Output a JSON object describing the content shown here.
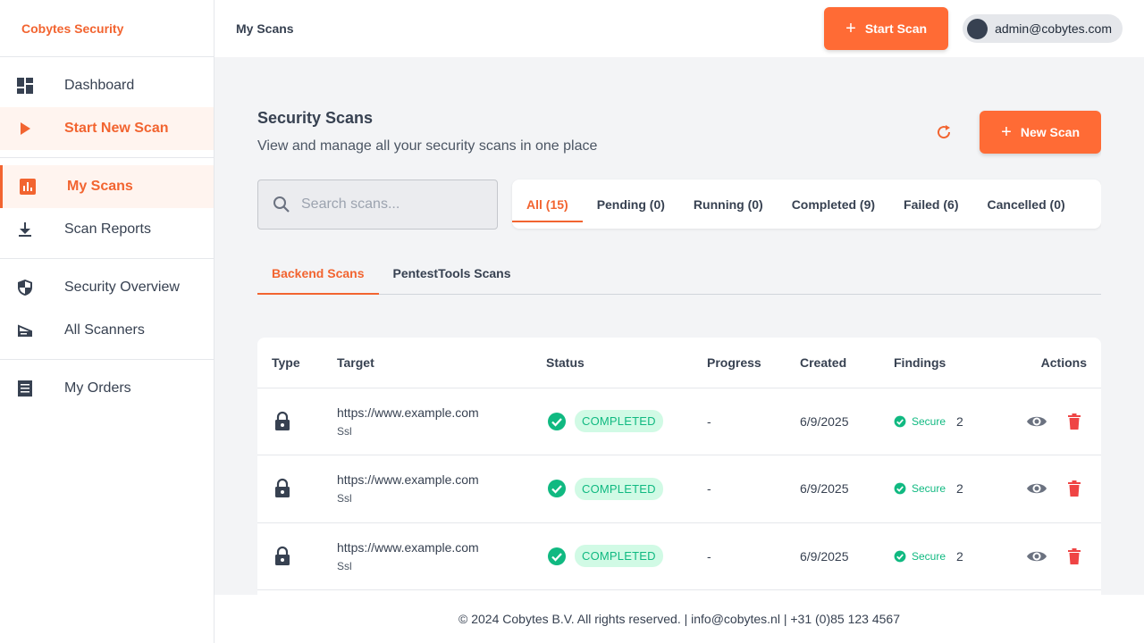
{
  "app": {
    "brand": "Cobytes Security"
  },
  "sidebar": {
    "groups": [
      [
        {
          "label": "Dashboard",
          "icon": "dashboard-icon"
        },
        {
          "label": "Start New Scan",
          "icon": "play-icon"
        }
      ],
      [
        {
          "label": "My Scans",
          "icon": "bar-chart-icon"
        },
        {
          "label": "Scan Reports",
          "icon": "download-icon"
        }
      ],
      [
        {
          "label": "Security Overview",
          "icon": "shield-icon"
        },
        {
          "label": "All Scanners",
          "icon": "scanner-icon"
        }
      ],
      [
        {
          "label": "My Orders",
          "icon": "receipt-icon"
        }
      ]
    ]
  },
  "header": {
    "title": "My Scans",
    "start_scan_label": "Start Scan",
    "user_email": "admin@cobytes.com"
  },
  "main": {
    "title": "Security Scans",
    "subtitle": "View and manage all your security scans in one place",
    "new_scan_label": "New Scan",
    "search_placeholder": "Search scans...",
    "filter_tabs": [
      "All (15)",
      "Pending (0)",
      "Running (0)",
      "Completed (9)",
      "Failed (6)",
      "Cancelled (0)"
    ],
    "type_tabs": [
      "Backend Scans",
      "PentestTools Scans"
    ],
    "table": {
      "headers": [
        "Type",
        "Target",
        "Status",
        "Progress",
        "Created",
        "Findings",
        "Actions"
      ],
      "rows": [
        {
          "url": "https://www.example.com",
          "scan_type": "Ssl",
          "status": "COMPLETED",
          "progress": "-",
          "created": "6/9/2025",
          "finding_label": "Secure",
          "finding_count": "2"
        },
        {
          "url": "https://www.example.com",
          "scan_type": "Ssl",
          "status": "COMPLETED",
          "progress": "-",
          "created": "6/9/2025",
          "finding_label": "Secure",
          "finding_count": "2"
        },
        {
          "url": "https://www.example.com",
          "scan_type": "Ssl",
          "status": "COMPLETED",
          "progress": "-",
          "created": "6/9/2025",
          "finding_label": "Secure",
          "finding_count": "2"
        }
      ]
    }
  },
  "footer": {
    "text": "© 2024 Cobytes B.V. All rights reserved. | info@cobytes.nl | +31 (0)85 123 4567"
  },
  "colors": {
    "accent": "#ff6b35",
    "success": "#10b981",
    "danger": "#ef4444"
  }
}
